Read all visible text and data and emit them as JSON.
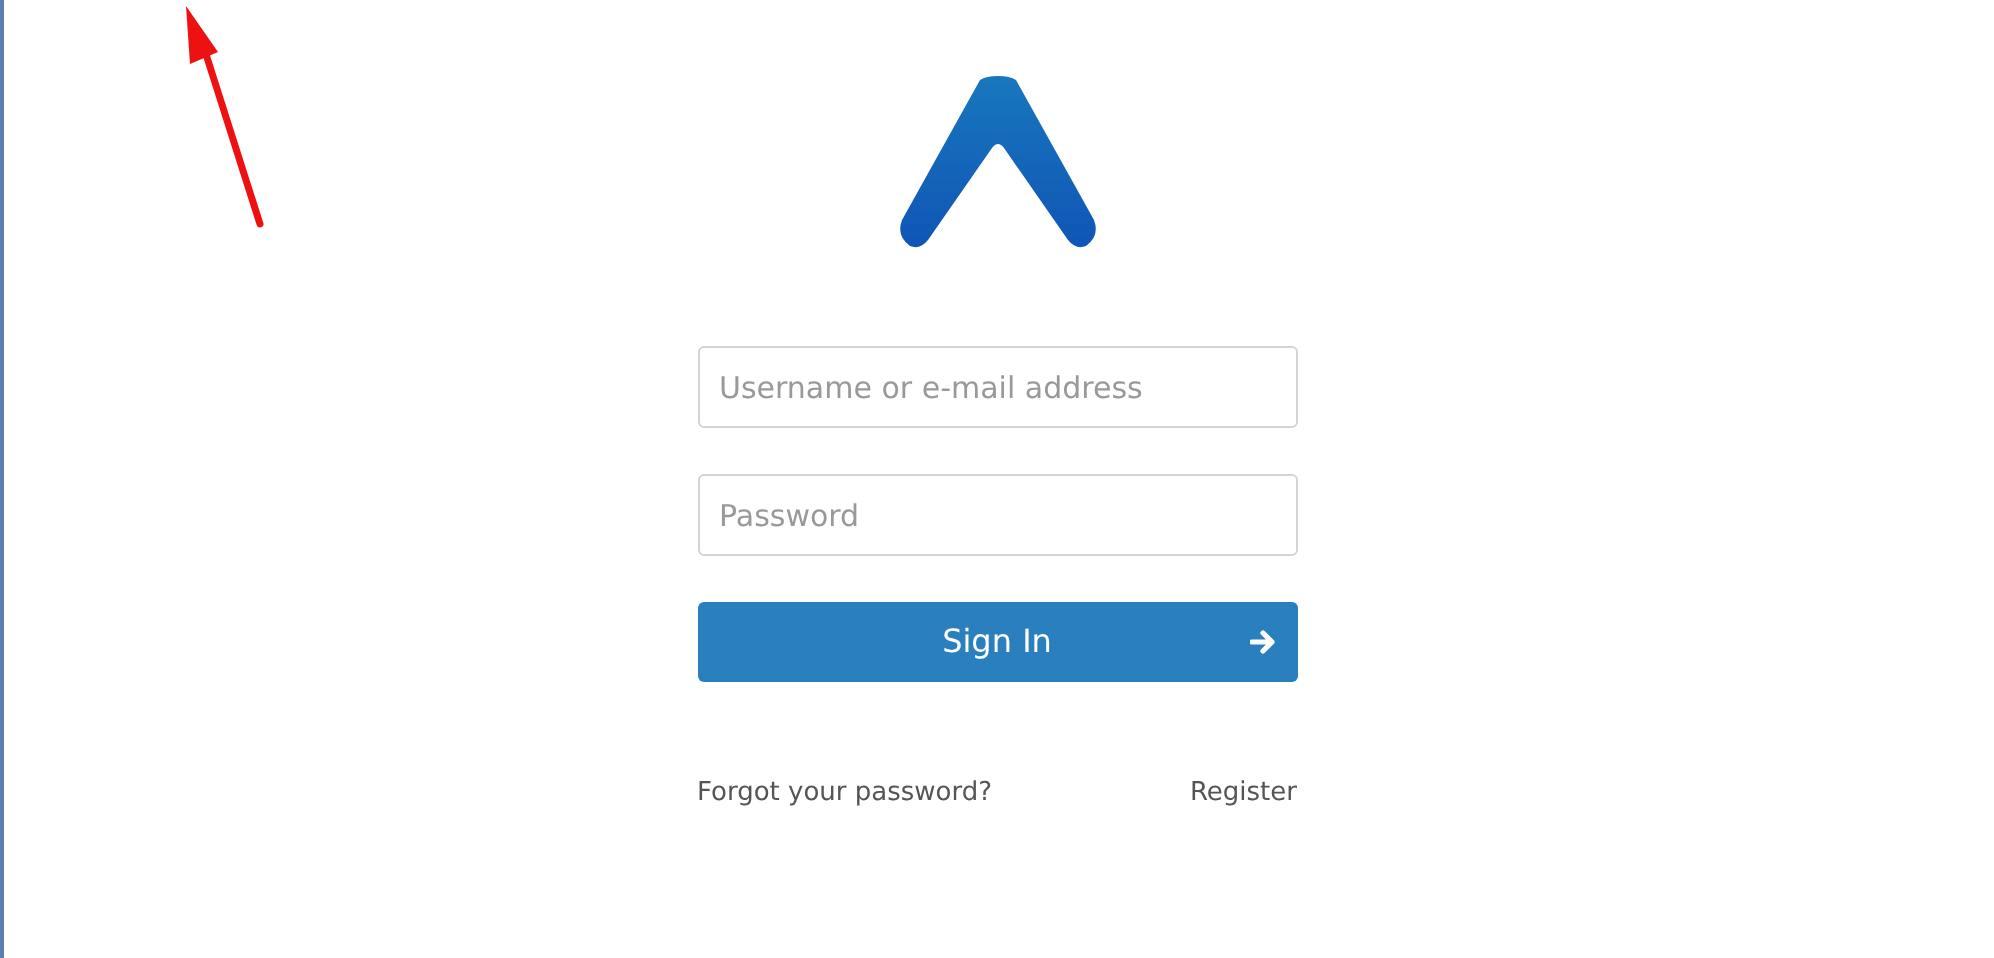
{
  "login": {
    "username": {
      "placeholder": "Username or e-mail address"
    },
    "password": {
      "placeholder": "Password"
    },
    "sign_in_button": {
      "label": "Sign In"
    },
    "links": [
      {
        "label": "Forgot your password?"
      },
      {
        "label": "Register"
      }
    ]
  }
}
